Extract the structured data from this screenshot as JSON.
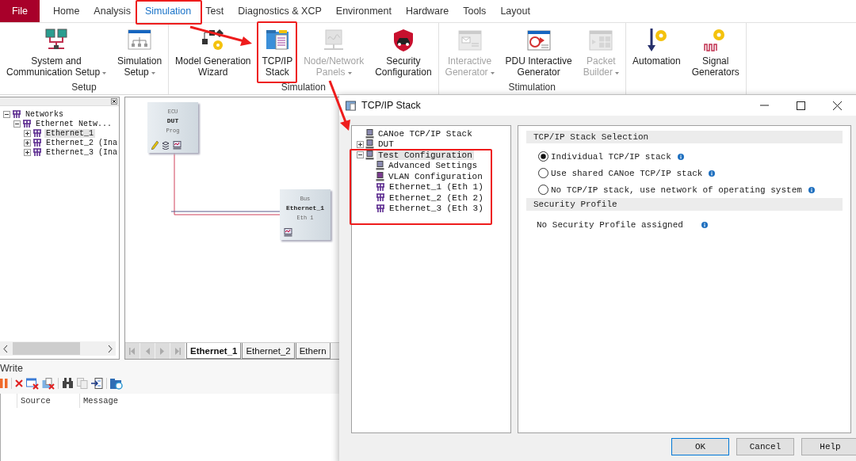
{
  "ribbon": {
    "tabs": [
      {
        "label": "File",
        "kind": "file",
        "selected": false
      },
      {
        "label": "Home",
        "kind": "tab",
        "selected": false
      },
      {
        "label": "Analysis",
        "kind": "tab",
        "selected": false
      },
      {
        "label": "Simulation",
        "kind": "tab",
        "selected": true
      },
      {
        "label": "Test",
        "kind": "tab",
        "selected": false
      },
      {
        "label": "Diagnostics & XCP",
        "kind": "tab",
        "selected": false
      },
      {
        "label": "Environment",
        "kind": "tab",
        "selected": false
      },
      {
        "label": "Hardware",
        "kind": "tab",
        "selected": false
      },
      {
        "label": "Tools",
        "kind": "tab",
        "selected": false
      },
      {
        "label": "Layout",
        "kind": "tab",
        "selected": false
      }
    ],
    "groups": [
      {
        "label": "Setup",
        "buttons": [
          {
            "label": "System and\nCommunication Setup",
            "kind": "network",
            "dropdown": true,
            "disabled": false
          },
          {
            "label": "Simulation\nSetup",
            "kind": "setup",
            "dropdown": true,
            "disabled": false
          }
        ]
      },
      {
        "label": "Simulation",
        "buttons": [
          {
            "label": "Model Generation\nWizard",
            "kind": "wizard",
            "dropdown": false,
            "disabled": false
          },
          {
            "label": "TCP/IP\nStack",
            "kind": "stack",
            "dropdown": false,
            "disabled": false
          },
          {
            "label": "Node/Network\nPanels",
            "kind": "panels",
            "dropdown": true,
            "disabled": true
          },
          {
            "label": "Security\nConfiguration",
            "kind": "security",
            "dropdown": false,
            "disabled": false
          }
        ]
      },
      {
        "label": "Stimulation",
        "buttons": [
          {
            "label": "Interactive\nGenerator",
            "kind": "generator",
            "dropdown": true,
            "disabled": true
          },
          {
            "label": "PDU Interactive\nGenerator",
            "kind": "pdu",
            "dropdown": false,
            "disabled": false
          },
          {
            "label": "Packet\nBuilder",
            "kind": "packet",
            "dropdown": true,
            "disabled": true
          }
        ]
      },
      {
        "buttons": [
          {
            "label": "Automation",
            "kind": "automation",
            "dropdown": false,
            "disabled": false
          },
          {
            "label": "Signal\nGenerators",
            "kind": "signal",
            "dropdown": false,
            "disabled": false
          }
        ]
      }
    ]
  },
  "networks_panel": {
    "tree": [
      {
        "label": "Networks",
        "expanded": true,
        "selected": false,
        "children": [
          {
            "label": "Ethernet Netw...",
            "expanded": true,
            "selected": false,
            "children": [
              {
                "label": "Ethernet_1",
                "expanded": false,
                "selected": true
              },
              {
                "label": "Ethernet_2 (Ina",
                "expanded": false,
                "selected": false
              },
              {
                "label": "Ethernet_3 (Ina",
                "expanded": false,
                "selected": false
              }
            ]
          }
        ]
      }
    ]
  },
  "canvas": {
    "nodes": [
      {
        "kind": "ecu",
        "lines": [
          "ECU",
          "DUT",
          "Prog"
        ]
      },
      {
        "kind": "bus",
        "lines": [
          "Bus",
          "Ethernet_1",
          "Eth 1"
        ]
      }
    ],
    "tabs": [
      {
        "label": "Ethernet_1",
        "selected": true
      },
      {
        "label": "Ethernet_2",
        "selected": false
      },
      {
        "label": "Ethern",
        "selected": false
      }
    ]
  },
  "write_panel": {
    "title": "Write",
    "columns": [
      "Source",
      "Message"
    ]
  },
  "dialog": {
    "title": "TCP/IP Stack",
    "tree": [
      {
        "label": "CANoe TCP/IP Stack",
        "kind": "computer",
        "selected": false
      },
      {
        "label": "DUT",
        "kind": "computer",
        "expanded": false,
        "selected": false
      },
      {
        "label": "Test Configuration",
        "kind": "computer",
        "expanded": true,
        "selected": true,
        "children": [
          {
            "label": "Advanced Settings",
            "kind": "computer",
            "selected": false
          },
          {
            "label": "VLAN Configuration",
            "kind": "vlan",
            "selected": false
          },
          {
            "label": "Ethernet_1 (Eth 1)",
            "kind": "network",
            "selected": false
          },
          {
            "label": "Ethernet_2 (Eth 2)",
            "kind": "network",
            "selected": false
          },
          {
            "label": "Ethernet_3 (Eth 3)",
            "kind": "network",
            "selected": false
          }
        ]
      }
    ],
    "sections": [
      {
        "title": "TCP/IP Stack Selection",
        "kind": "radios",
        "options": [
          {
            "label": "Individual TCP/IP stack",
            "selected": true
          },
          {
            "label": "Use shared CANoe TCP/IP stack",
            "selected": false
          },
          {
            "label": "No TCP/IP stack, use network of operating system",
            "selected": false
          }
        ]
      },
      {
        "title": "Security Profile",
        "kind": "note",
        "text": "No Security Profile assigned"
      }
    ],
    "buttons": [
      {
        "label": "OK",
        "default": true
      },
      {
        "label": "Cancel",
        "default": false
      },
      {
        "label": "Help",
        "default": false
      }
    ]
  }
}
